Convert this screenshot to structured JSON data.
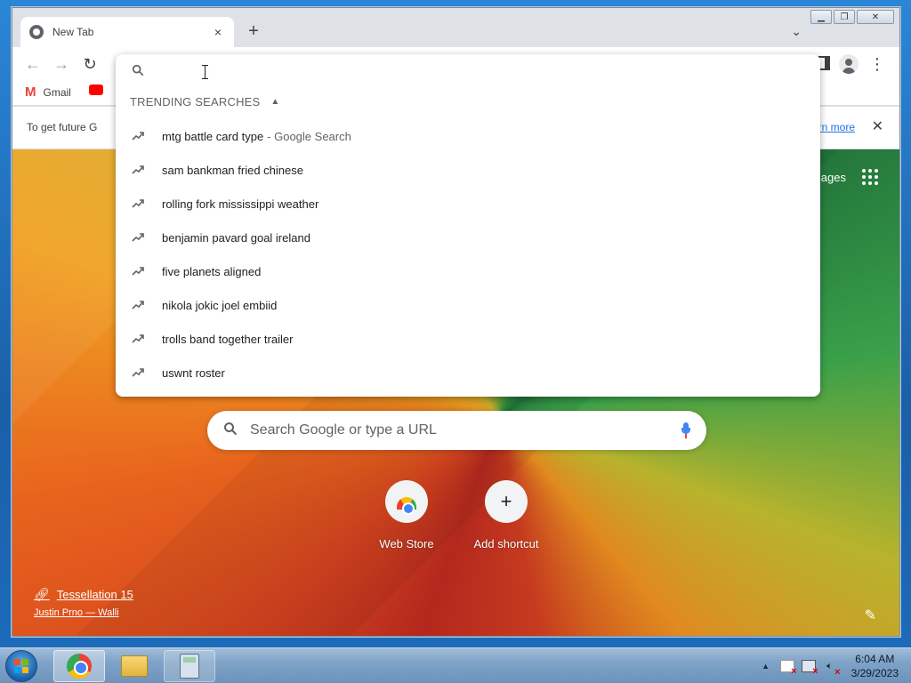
{
  "browser": {
    "tab_title": "New Tab",
    "new_tab_symbol": "+",
    "tab_close_symbol": "×",
    "tab_search_symbol": "⌄"
  },
  "toolbar": {
    "back_symbol": "←",
    "forward_symbol": "→",
    "reload_symbol": "↻",
    "menu_symbol": "⋮"
  },
  "bookmarks": [
    {
      "label": "Gmail",
      "icon": "gmail-icon"
    },
    {
      "label": "",
      "icon": "youtube-icon"
    }
  ],
  "infobar": {
    "text": "To get future G",
    "learn_more": "earn more",
    "close_symbol": "✕"
  },
  "omnibox": {
    "input_value": "",
    "trending_header": "TRENDING SEARCHES",
    "trending_toggle": "▲",
    "suggestions": [
      {
        "text": "mtg battle card type",
        "suffix": "- Google Search"
      },
      {
        "text": "sam bankman fried chinese",
        "suffix": ""
      },
      {
        "text": "rolling fork mississippi weather",
        "suffix": ""
      },
      {
        "text": "benjamin pavard goal ireland",
        "suffix": ""
      },
      {
        "text": "five planets aligned",
        "suffix": ""
      },
      {
        "text": "nikola jokic joel embiid",
        "suffix": ""
      },
      {
        "text": "trolls band together trailer",
        "suffix": ""
      },
      {
        "text": "uswnt roster",
        "suffix": ""
      }
    ]
  },
  "ntp": {
    "images_link": "nages",
    "search_placeholder": "Search Google or type a URL",
    "shortcuts": [
      {
        "label": "Web Store",
        "icon": "webstore-icon"
      },
      {
        "label": "Add shortcut",
        "icon": "plus-icon",
        "symbol": "+"
      }
    ],
    "background_title": "Tessellation 15",
    "background_author": "Justin Prno — Walli",
    "customize_symbol": "✎"
  },
  "taskbar": {
    "apps": [
      "chrome-icon",
      "file-explorer-icon",
      "calculator-icon"
    ],
    "tray_expand": "▲",
    "time": "6:04 AM",
    "date": "3/29/2023"
  },
  "colors": {
    "accent": "#1a73e8",
    "tab_strip": "#dee1e6"
  }
}
